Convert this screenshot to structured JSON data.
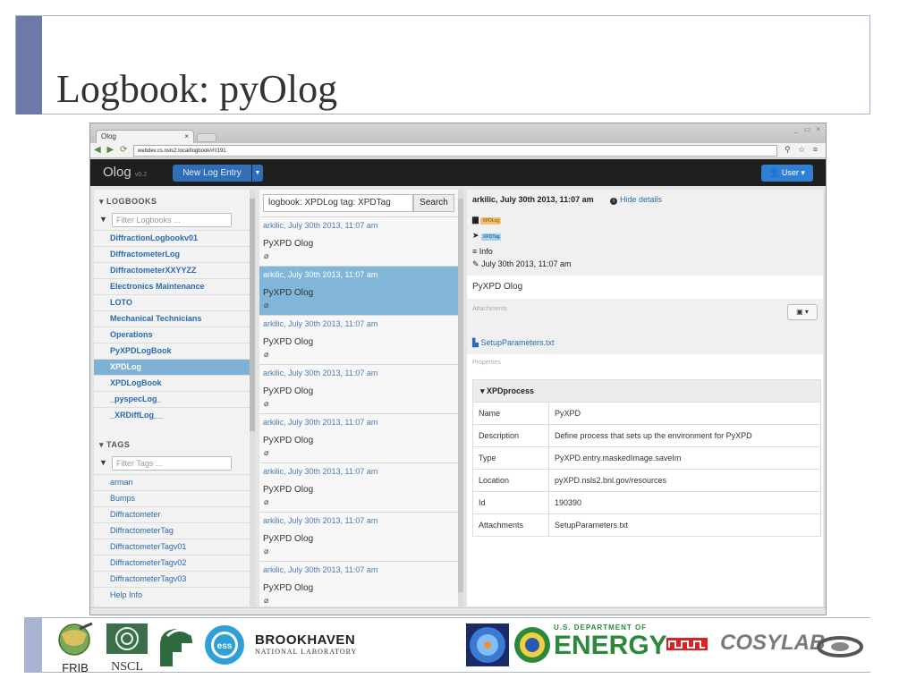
{
  "slide": {
    "title": "Logbook: pyOlog"
  },
  "browser": {
    "tab_title": "Olog",
    "tab_close": "×",
    "url": "webdev.cs.nsls2.local/logbook/#!/191"
  },
  "navbar": {
    "brand": "Olog",
    "version": "v0.2",
    "new_log_entry": "New Log Entry",
    "user_button": "User"
  },
  "logbooks": {
    "header": "LOGBOOKS",
    "filter_placeholder": "Filter Logbooks ...",
    "items": [
      {
        "label": "DiffractionLogbookv01"
      },
      {
        "label": "DiffractometerLog"
      },
      {
        "label": "DiffractometerXXYYZZ"
      },
      {
        "label": "Electronics Maintenance"
      },
      {
        "label": "LOTO"
      },
      {
        "label": "Mechanical Technicians"
      },
      {
        "label": "Operations"
      },
      {
        "label": "PyXPDLogBook"
      },
      {
        "label": "XPDLog"
      },
      {
        "label": "XPDLogBook"
      },
      {
        "label": "_pyspecLog_"
      },
      {
        "label": "_XRDiffLog__"
      }
    ],
    "active_index": 8
  },
  "tags": {
    "header": "TAGS",
    "filter_placeholder": "Filter Tags ...",
    "items": [
      {
        "label": "arman"
      },
      {
        "label": "Bumps"
      },
      {
        "label": "Diffractometer"
      },
      {
        "label": "DiffractometerTag"
      },
      {
        "label": "DiffractometerTagv01"
      },
      {
        "label": "DiffractometerTagv02"
      },
      {
        "label": "DiffractometerTagv03"
      },
      {
        "label": "Help Info"
      }
    ]
  },
  "search": {
    "query": "logbook: XPDLog tag: XPDTag",
    "button": "Search"
  },
  "entries": [
    {
      "meta": "arkilic, July 30th 2013, 11:07 am",
      "text": "PyXPD Olog"
    },
    {
      "meta": "arkilic, July 30th 2013, 11:07 am",
      "text": "PyXPD Olog"
    },
    {
      "meta": "arkilic, July 30th 2013, 11:07 am",
      "text": "PyXPD Olog"
    },
    {
      "meta": "arkilic, July 30th 2013, 11:07 am",
      "text": "PyXPD Olog"
    },
    {
      "meta": "arkilic, July 30th 2013, 11:07 am",
      "text": "PyXPD Olog"
    },
    {
      "meta": "arkilic, July 30th 2013, 11:07 am",
      "text": "PyXPD Olog"
    },
    {
      "meta": "arkilic, July 30th 2013, 11:07 am",
      "text": "PyXPD Olog"
    },
    {
      "meta": "arkilic, July 30th 2013, 11:07 am",
      "text": "PyXPD Olog"
    }
  ],
  "selected_entry_index": 1,
  "detail": {
    "header": "arkilic, July 30th 2013, 11:07 am",
    "hide_details": "Hide details",
    "logbook_chip": "XPDLog",
    "tag_chip": "XPDTag",
    "info_label": "Info",
    "date": "July 30th 2013, 11:07 am",
    "description": "PyXPD Olog",
    "attachments_label": "Attachments",
    "attachment_file": "SetupParameters.txt",
    "properties_label": "Properties",
    "property_group": "XPDprocess",
    "properties": [
      {
        "key": "Name",
        "value": "PyXPD"
      },
      {
        "key": "Description",
        "value": "Define process that sets up the environment for PyXPD"
      },
      {
        "key": "Type",
        "value": "PyXPD.entry.maskedImage.saveIm"
      },
      {
        "key": "Location",
        "value": "pyXPD.nsls2.bnl.gov/resources"
      },
      {
        "key": "Id",
        "value": "190390"
      },
      {
        "key": "Attachments",
        "value": "SetupParameters.txt"
      }
    ]
  },
  "logos": {
    "frib": "FRIB",
    "nscl": "NSCL",
    "brookhaven": "BROOKHAVEN",
    "bnl_sub": "NATIONAL LABORATORY",
    "doe_top": "U.S. DEPARTMENT OF",
    "energy": "ENERGY",
    "cosylab": "COSYLAB"
  },
  "colors": {
    "slide_accent": "#6b7aa8",
    "link_blue": "#2a6bb0",
    "selected_row": "#82b6d8",
    "navbar": "#1f1f1f",
    "button_blue": "#2f7fd2",
    "logbook_chip": "#f0c070",
    "tag_chip": "#9fd0f0"
  }
}
